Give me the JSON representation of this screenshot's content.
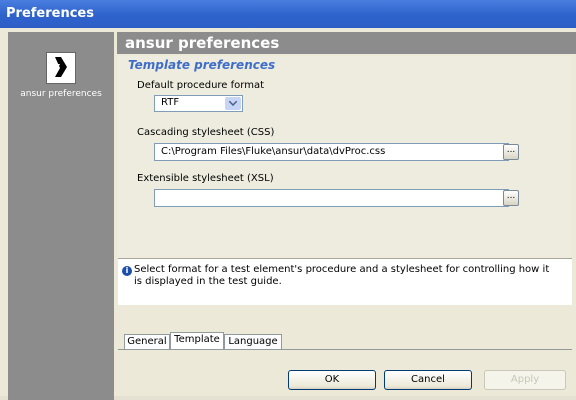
{
  "window": {
    "title": "Preferences"
  },
  "sidebar": {
    "item_label": "ansur preferences",
    "logo_icon": "ansur-logo-icon"
  },
  "header": {
    "title": "ansur preferences"
  },
  "template": {
    "section_title": "Template preferences",
    "default_format_label": "Default procedure format",
    "default_format_value": "RTF",
    "css_label": "Cascading stylesheet (CSS)",
    "css_value": "C:\\Program Files\\Fluke\\ansur\\data\\dvProc.css",
    "xsl_label": "Extensible stylesheet (XSL)",
    "xsl_value": "",
    "browse_label": "..."
  },
  "help": {
    "icon": "info-icon",
    "text": "Select format for a test element's procedure and a stylesheet for controlling how it is displayed in the test guide."
  },
  "tabs": [
    {
      "label": "General",
      "active": false
    },
    {
      "label": "Template",
      "active": true
    },
    {
      "label": "Language",
      "active": false
    }
  ],
  "buttons": {
    "ok": "OK",
    "cancel": "Cancel",
    "apply": "Apply"
  },
  "colors": {
    "titlebar": "#2f64cc",
    "section_title": "#3f6ec9",
    "sidebar": "#8c8c8c"
  }
}
